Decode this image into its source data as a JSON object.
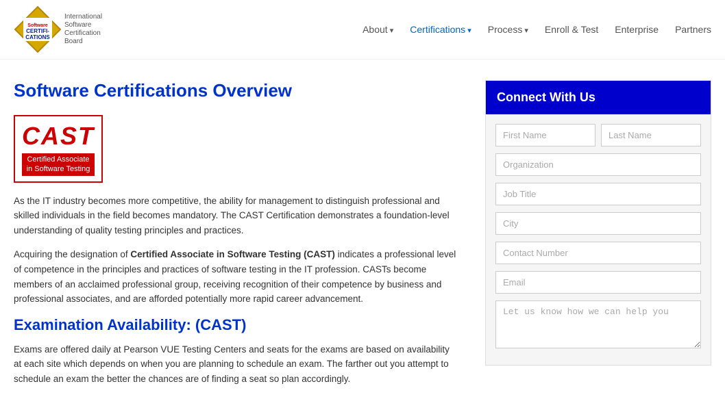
{
  "header": {
    "logo_text": "Software CERTIFICATIONS",
    "logo_sub": "International Software Certification Board",
    "watermark": "CERTIFICATIONS"
  },
  "nav": {
    "items": [
      {
        "label": "About",
        "dropdown": true,
        "active": false
      },
      {
        "label": "Certifications",
        "dropdown": true,
        "active": true
      },
      {
        "label": "Process",
        "dropdown": true,
        "active": false
      },
      {
        "label": "Enroll & Test",
        "dropdown": false,
        "active": false
      },
      {
        "label": "Enterprise",
        "dropdown": false,
        "active": false
      },
      {
        "label": "Partners",
        "dropdown": false,
        "active": false
      }
    ]
  },
  "content": {
    "page_title": "Software Certifications Overview",
    "cast_logo_text": "CAST",
    "cast_logo_sub": "Certified Associate in Software Testing",
    "paragraph1": "As the IT industry becomes more competitive, the ability for management to distinguish professional and skilled individuals in the field becomes mandatory. The CAST Certification demonstrates a foundation-level understanding of quality testing principles and practices.",
    "paragraph2_prefix": "Acquiring the designation of ",
    "paragraph2_bold": "Certified Associate in Software Testing (CAST)",
    "paragraph2_suffix": " indicates a professional level of competence in the principles and practices of software testing in the IT profession. CASTs become members of an acclaimed professional group, receiving recognition of their competence by business and professional associates, and are afforded potentially more rapid career advancement.",
    "exam_title": "Examination Availability: (CAST)",
    "exam_text": "Exams are offered daily at Pearson VUE Testing Centers and seats for the exams are based on availability at each site which depends on when you are planning to schedule an exam. The farther out you attempt to schedule an exam the better the chances are of finding a seat so plan accordingly."
  },
  "form": {
    "header_title": "Connect With Us",
    "first_name_placeholder": "First Name",
    "last_name_placeholder": "Last Name",
    "organization_placeholder": "Organization",
    "job_title_placeholder": "Job Title",
    "city_placeholder": "City",
    "contact_number_placeholder": "Contact Number",
    "email_placeholder": "Email",
    "message_placeholder": "Let us know how we can help you"
  }
}
